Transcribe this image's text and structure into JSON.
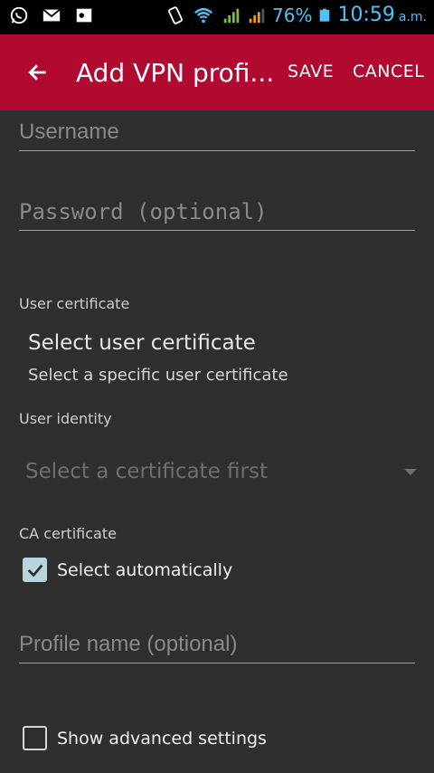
{
  "status_bar": {
    "icons": [
      "whatsapp-icon",
      "gmail-icon",
      "outlook-icon",
      "vibrate-icon",
      "wifi-icon",
      "signal-icon",
      "signal-icon-2",
      "battery-icon"
    ],
    "battery_percent": "76%",
    "time": "10:59",
    "ampm": "a.m.",
    "accent_color": "#4fc3f7"
  },
  "app_bar": {
    "title": "Add VPN profi...",
    "save_label": "SAVE",
    "cancel_label": "CANCEL",
    "background_color": "#b00a30"
  },
  "form": {
    "username_placeholder": "Username",
    "password_placeholder": "Password (optional)",
    "user_certificate_label": "User certificate",
    "user_certificate_title": "Select user certificate",
    "user_certificate_subtitle": "Select a specific user certificate",
    "user_identity_label": "User identity",
    "user_identity_value": "Select a certificate first",
    "ca_certificate_label": "CA certificate",
    "select_automatically_label": "Select automatically",
    "select_automatically_checked": true,
    "profile_name_placeholder": "Profile name (optional)",
    "show_advanced_label": "Show advanced settings",
    "show_advanced_checked": false
  }
}
